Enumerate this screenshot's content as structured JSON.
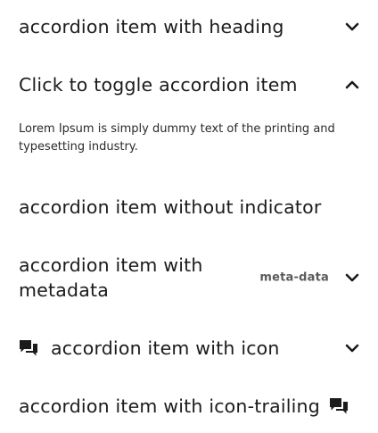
{
  "accordion": {
    "items": [
      {
        "title": "accordion item with heading",
        "expanded": false,
        "indicator": "chevron-down-icon"
      },
      {
        "title": "Click to toggle accordion item",
        "expanded": true,
        "indicator": "chevron-up-icon",
        "content": "Lorem Ipsum is simply dummy text of the printing and typesetting industry."
      },
      {
        "title": "accordion item without indicator",
        "expanded": false
      },
      {
        "title": "accordion item with metadata",
        "metadata": "meta-data",
        "expanded": false,
        "indicator": "chevron-down-icon"
      },
      {
        "title": "accordion item with icon",
        "leading_icon": "chat-bubbles-icon",
        "expanded": false,
        "indicator": "chevron-down-icon"
      },
      {
        "title": "accordion item with icon-trailing",
        "trailing_icon": "chat-bubbles-icon",
        "expanded": false
      }
    ]
  },
  "colors": {
    "text": "#1b1b1b",
    "meta": "#5b5b5b",
    "background": "#ffffff"
  }
}
